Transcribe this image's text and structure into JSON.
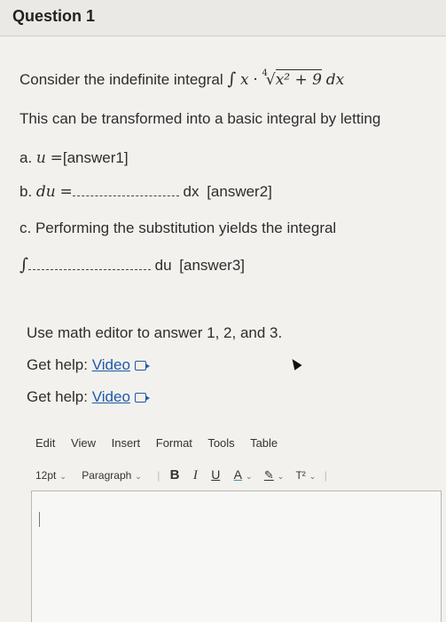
{
  "header": {
    "title": "Question 1"
  },
  "question": {
    "intro": "Consider the indefinite integral",
    "integral_sign": "∫",
    "integrand_x": "x",
    "dot": "·",
    "root_index": "4",
    "radicand": "x² + 9",
    "dx": "dx",
    "transform_text": "This can be transformed into a basic integral by letting",
    "part_a": {
      "label": "a.",
      "var": "u",
      "eq": "=",
      "answer": "[answer1]"
    },
    "part_b": {
      "label": "b.",
      "var": "du",
      "eq": "=",
      "unit": "dx",
      "answer": "[answer2]"
    },
    "part_c": {
      "label": "c.",
      "text": "Performing the substitution yields the integral"
    },
    "part_c_line": {
      "integral_sign": "∫",
      "unit": "du",
      "answer": "[answer3]"
    }
  },
  "instructions": "Use math editor to answer 1, 2, and 3.",
  "help": [
    {
      "label": "Get help:",
      "link": "Video"
    },
    {
      "label": "Get help:",
      "link": "Video"
    }
  ],
  "editor": {
    "menu": [
      "Edit",
      "View",
      "Insert",
      "Format",
      "Tools",
      "Table"
    ],
    "font_size": "12pt",
    "block_format": "Paragraph",
    "bold": "B",
    "italic": "I",
    "underline": "U",
    "font_color": "A",
    "highlight": "✎",
    "superscript": "T²"
  }
}
